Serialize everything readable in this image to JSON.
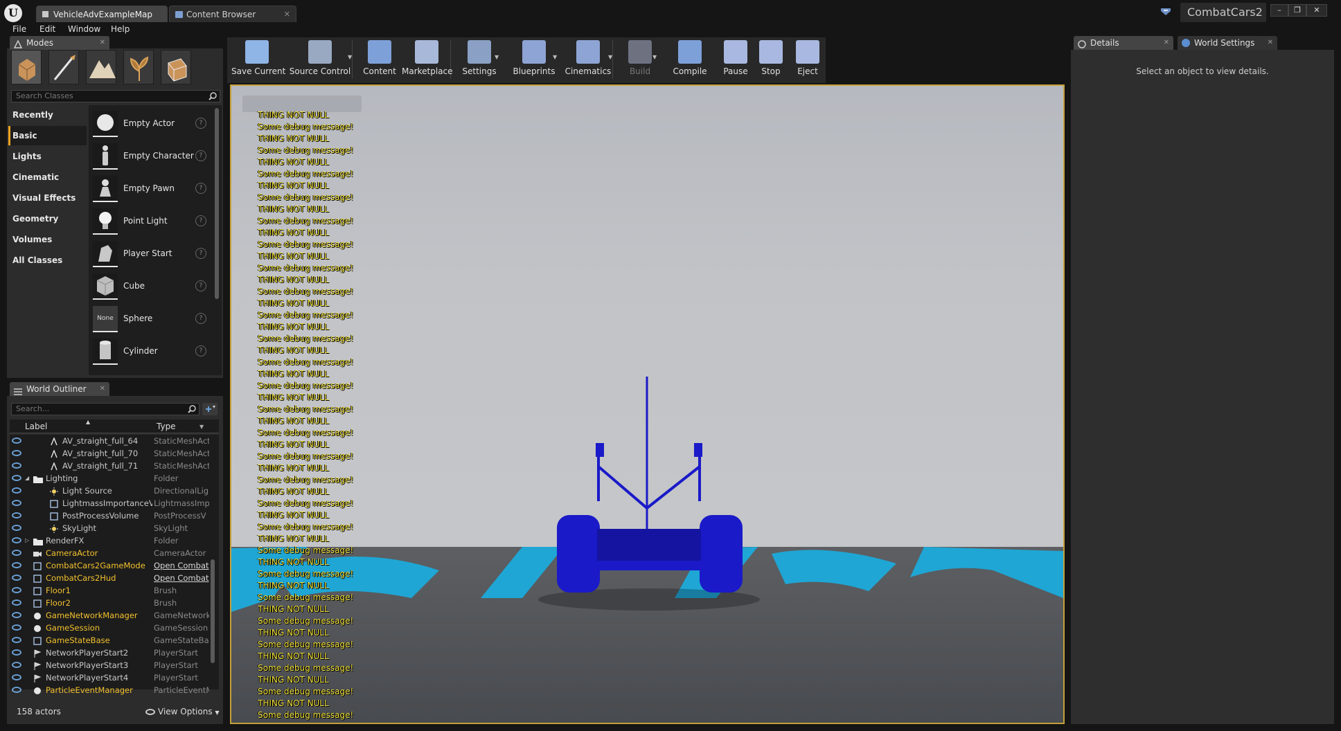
{
  "title_bar": {
    "tabs": [
      {
        "label": "VehicleAdvExampleMap",
        "active": true
      },
      {
        "label": "Content Browser",
        "active": false
      }
    ],
    "project_name": "CombatCars2"
  },
  "menu": [
    "File",
    "Edit",
    "Window",
    "Help"
  ],
  "modes_panel": {
    "tab_label": "Modes",
    "search_placeholder": "Search Classes",
    "categories": [
      "Recently Placed",
      "Basic",
      "Lights",
      "Cinematic",
      "Visual Effects",
      "Geometry",
      "Volumes",
      "All Classes"
    ],
    "active_category": "Basic",
    "items": [
      {
        "label": "Empty Actor",
        "icon": "sphere-thumb"
      },
      {
        "label": "Empty Character",
        "icon": "character-thumb"
      },
      {
        "label": "Empty Pawn",
        "icon": "pawn-thumb"
      },
      {
        "label": "Point Light",
        "icon": "light-bulb-thumb"
      },
      {
        "label": "Player Start",
        "icon": "player-start-thumb"
      },
      {
        "label": "Cube",
        "icon": "cube-thumb"
      },
      {
        "label": "Sphere",
        "icon": "none-thumb",
        "thumb_text": "None"
      },
      {
        "label": "Cylinder",
        "icon": "cylinder-thumb"
      }
    ]
  },
  "outliner": {
    "tab_label": "World Outliner",
    "search_placeholder": "Search...",
    "col_label": "Label",
    "col_type": "Type",
    "rows": [
      {
        "name": "AV_straight_full_64",
        "type": "StaticMeshAct",
        "indent": 2,
        "icon": "mesh"
      },
      {
        "name": "AV_straight_full_70",
        "type": "StaticMeshAct",
        "indent": 2,
        "icon": "mesh"
      },
      {
        "name": "AV_straight_full_71",
        "type": "StaticMeshAct",
        "indent": 2,
        "icon": "mesh"
      },
      {
        "name": "Lighting",
        "type": "Folder",
        "indent": 1,
        "icon": "folder",
        "expanded": true
      },
      {
        "name": "Light Source",
        "type": "DirectionalLigl",
        "indent": 2,
        "icon": "sun"
      },
      {
        "name": "LightmassImportanceV",
        "type": "LightmassImp",
        "indent": 2,
        "icon": "box"
      },
      {
        "name": "PostProcessVolume",
        "type": "PostProcessV",
        "indent": 2,
        "icon": "box"
      },
      {
        "name": "SkyLight",
        "type": "SkyLight",
        "indent": 2,
        "icon": "sun"
      },
      {
        "name": "RenderFX",
        "type": "Folder",
        "indent": 1,
        "icon": "folder",
        "collapsed": true
      },
      {
        "name": "CameraActor",
        "type": "CameraActor",
        "indent": 1,
        "icon": "camera",
        "highlight": true
      },
      {
        "name": "CombatCars2GameMode",
        "type": "Open Combat",
        "indent": 1,
        "icon": "box",
        "highlight": true,
        "link": true
      },
      {
        "name": "CombatCars2Hud",
        "type": "Open Combat",
        "indent": 1,
        "icon": "box",
        "highlight": true,
        "link": true
      },
      {
        "name": "Floor1",
        "type": "Brush",
        "indent": 1,
        "icon": "box",
        "highlight": true
      },
      {
        "name": "Floor2",
        "type": "Brush",
        "indent": 1,
        "icon": "box",
        "highlight": true
      },
      {
        "name": "GameNetworkManager",
        "type": "GameNetworkI",
        "indent": 1,
        "icon": "ball",
        "highlight": true
      },
      {
        "name": "GameSession",
        "type": "GameSession",
        "indent": 1,
        "icon": "ball",
        "highlight": true
      },
      {
        "name": "GameStateBase",
        "type": "GameStateBas",
        "indent": 1,
        "icon": "box",
        "highlight": true
      },
      {
        "name": "NetworkPlayerStart2",
        "type": "PlayerStart",
        "indent": 1,
        "icon": "flag"
      },
      {
        "name": "NetworkPlayerStart3",
        "type": "PlayerStart",
        "indent": 1,
        "icon": "flag"
      },
      {
        "name": "NetworkPlayerStart4",
        "type": "PlayerStart",
        "indent": 1,
        "icon": "flag"
      },
      {
        "name": "ParticleEventManager",
        "type": "ParticleEventM",
        "indent": 1,
        "icon": "ball",
        "highlight": true
      }
    ],
    "actor_count": "158 actors",
    "view_options": "View Options"
  },
  "toolbar": [
    {
      "label": "Save Current",
      "icon": "save-icon",
      "color": "#8fb4e6"
    },
    {
      "label": "Source Control",
      "icon": "source-control-icon",
      "color": "#9aa9c2",
      "dropdown": true
    },
    {
      "label": "Content",
      "icon": "content-icon",
      "color": "#7ea0d8"
    },
    {
      "label": "Marketplace",
      "icon": "marketplace-icon",
      "color": "#a8b8d8"
    },
    {
      "label": "Settings",
      "icon": "settings-icon",
      "color": "#8aa0c4",
      "dropdown": true
    },
    {
      "label": "Blueprints",
      "icon": "blueprints-icon",
      "color": "#8ea4d4",
      "dropdown": true
    },
    {
      "label": "Cinematics",
      "icon": "cinematics-icon",
      "color": "#8ea4d4",
      "dropdown": true
    },
    {
      "label": "Build",
      "icon": "build-icon",
      "color": "#6e7280",
      "disabled": true,
      "dropdown": true
    },
    {
      "label": "Compile",
      "icon": "compile-icon",
      "color": "#7ea0d8"
    },
    {
      "label": "Pause",
      "icon": "pause-icon",
      "color": "#a8b8e0"
    },
    {
      "label": "Stop",
      "icon": "stop-icon",
      "color": "#a8b8e0"
    },
    {
      "label": "Eject",
      "icon": "eject-icon",
      "color": "#a8b8e0"
    }
  ],
  "viewport": {
    "debug_line_a": "THING NOT NULL",
    "debug_line_b": "Some debug message!",
    "floor_color": "#1fa6d4",
    "vehicle_color": "#1a1ac8"
  },
  "details_panel": {
    "tabs": [
      "Details",
      "World Settings"
    ],
    "empty_text": "Select an object to view details."
  },
  "colors": {
    "accent": "#f0a41e",
    "viewport_border": "#c4a13a",
    "highlight_text": "#f3c12e"
  }
}
